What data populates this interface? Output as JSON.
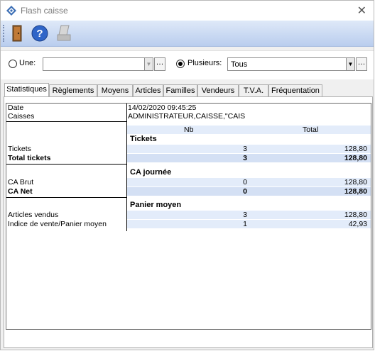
{
  "window": {
    "title": "Flash caisse",
    "close_glyph": "✕"
  },
  "toolbar": {
    "buttons": [
      "exit-door-icon",
      "help-icon",
      "print-icon"
    ]
  },
  "filters": {
    "une_label": "Une:",
    "une_value": "",
    "plusieurs_label": "Plusieurs:",
    "plusieurs_value": "Tous",
    "selected": "Plusieurs"
  },
  "tabs": [
    "Statistiques",
    "Règlements",
    "Moyens",
    "Articles",
    "Familles",
    "Vendeurs",
    "T.V.A.",
    "Fréquentation"
  ],
  "stats": {
    "date_label": "Date",
    "date_value": "14/02/2020 09:45:25",
    "caisses_label": "Caisses",
    "caisses_value": "ADMINISTRATEUR,CAISSE,\"CAIS",
    "col_nb": "Nb",
    "col_total": "Total",
    "sections": {
      "tickets": "Tickets",
      "ca": "CA journée",
      "panier": "Panier moyen"
    },
    "rows": {
      "tickets": {
        "label": "Tickets",
        "nb": "3",
        "total": "128,80"
      },
      "total_tickets": {
        "label": "Total tickets",
        "nb": "3",
        "total": "128,80"
      },
      "ca_brut": {
        "label": "CA Brut",
        "nb": "0",
        "total": "128,80"
      },
      "ca_net": {
        "label": "CA Net",
        "nb": "0",
        "total": "128,80"
      },
      "articles": {
        "label": "Articles vendus",
        "nb": "3",
        "total": "128,80"
      },
      "indice": {
        "label": "Indice de vente/Panier moyen",
        "nb": "1",
        "total": "42,93"
      }
    }
  }
}
